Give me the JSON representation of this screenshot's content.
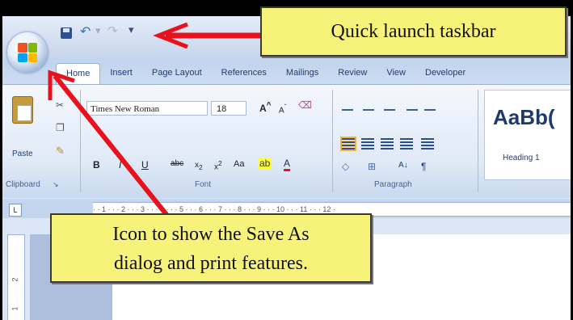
{
  "quick_access": {
    "save_icon": "save-icon",
    "undo_icon": "undo-icon",
    "redo_icon": "redo-icon",
    "more_icon": "customize-icon"
  },
  "office_button": {
    "colors": [
      "#f25022",
      "#7fba00",
      "#00a4ef",
      "#ffb900"
    ]
  },
  "tabs": [
    {
      "label": "Home"
    },
    {
      "label": "Insert"
    },
    {
      "label": "Page Layout"
    },
    {
      "label": "References"
    },
    {
      "label": "Mailings"
    },
    {
      "label": "Review"
    },
    {
      "label": "View"
    },
    {
      "label": "Developer"
    }
  ],
  "ribbon": {
    "clipboard": {
      "paste_label": "Paste",
      "group_label": "Clipboard"
    },
    "font": {
      "font_name": "Times New Roman",
      "font_size": "18",
      "group_label": "Font"
    },
    "paragraph": {
      "group_label": "Paragraph"
    },
    "styles": {
      "sample": "AaBb(",
      "style_name": "Heading 1"
    }
  },
  "ruler": {
    "corner": "L",
    "ticks": "· · 1 · · · 2 · · · 3 · · · 4 · · · 5 · · · 6 · · · 7 · · · 8 · · · 9 · · · 10 · · · 11 · · · 12 ·",
    "vertical_numbers": [
      "2",
      "1"
    ]
  },
  "callouts": {
    "top": "Quick launch taskbar",
    "bottom_line1": "Icon to show the Save As",
    "bottom_line2": "dialog and print features."
  },
  "colors": {
    "annotation_red": "#e8121c",
    "callout_yellow": "#f7f27a"
  }
}
